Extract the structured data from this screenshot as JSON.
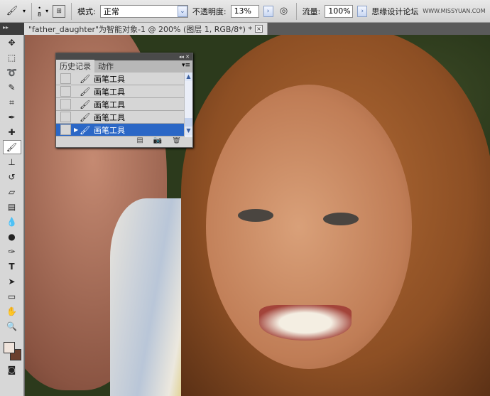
{
  "options_bar": {
    "brush_size": "8",
    "mode_label": "模式:",
    "mode_value": "正常",
    "opacity_label": "不透明度:",
    "opacity_value": "13%",
    "flow_label": "流量:",
    "flow_value": "100%",
    "watermark_cn": "思缘设计论坛",
    "watermark_url": "WWW.MISSYUAN.COM"
  },
  "document": {
    "tab_title": "\"father_daughter\"为智能对象-1 @ 200% (图层 1, RGB/8*) *",
    "close": "×"
  },
  "history_panel": {
    "tabs": [
      "历史记录",
      "动作"
    ],
    "items": [
      "画笔工具",
      "画笔工具",
      "画笔工具",
      "画笔工具",
      "画笔工具"
    ],
    "current_index": 4,
    "collapse": "◂◂ ✕"
  },
  "colors": {
    "accent": "#2b67c6",
    "foreground": "#f0e4dc",
    "background": "#6b3f2e"
  }
}
